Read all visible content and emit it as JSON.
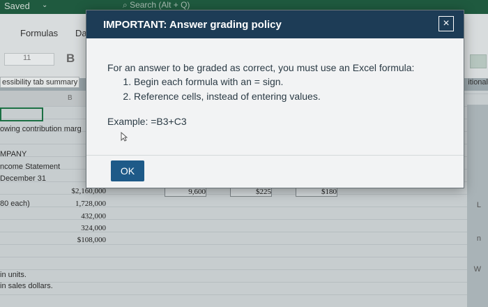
{
  "app": {
    "saved_label": "Saved",
    "search_placeholder": "Search (Alt + Q)"
  },
  "ribbon": {
    "tabs": [
      "Formulas",
      "Da"
    ],
    "font_size": "11",
    "bold_label": "B"
  },
  "sheet": {
    "accessibility_label": "essibility tab summary",
    "additional_label": "itional",
    "column_b_header": "B",
    "side_text": [
      "owing contribution marg",
      "MPANY",
      "ncome Statement",
      "December 31",
      "80 each)",
      "in units.",
      "in sales dollars."
    ],
    "values_col_b": [
      "$2,160,000",
      "1,728,000",
      "432,000",
      "324,000",
      "$108,000"
    ],
    "values_row": [
      "9,600",
      "$225",
      "$180"
    ],
    "right_icons": [
      "L",
      "n",
      "W"
    ]
  },
  "modal": {
    "title": "IMPORTANT: Answer grading policy",
    "close_glyph": "×",
    "intro": "For an answer to be graded as correct, you must use an Excel formula:",
    "rules": [
      "Begin each formula with an = sign.",
      "Reference cells, instead of entering values."
    ],
    "example": "Example: =B3+C3",
    "ok_label": "OK"
  }
}
